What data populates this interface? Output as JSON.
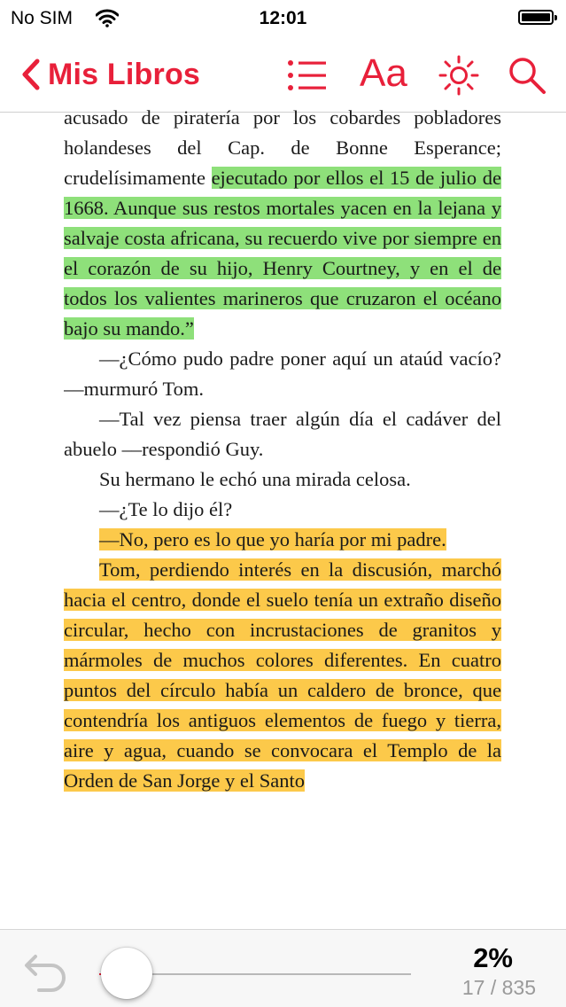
{
  "status": {
    "carrier": "No SIM",
    "time": "12:01",
    "battery_level": 1.0
  },
  "nav": {
    "back_label": "Mis Libros",
    "font_button_label": "Aa",
    "icons": [
      "chevron-left-icon",
      "list-icon",
      "font-size-icon",
      "brightness-icon",
      "search-icon"
    ]
  },
  "colors": {
    "accent": "#e8203a",
    "highlight_green": "#8ee07a",
    "highlight_yellow": "#fcc94a"
  },
  "book": {
    "p1_plain": "acusado de piratería por los cobardes pobladores holandeses del Cap. de Bonne Esperance; crudelísimamente ",
    "p1_highlight": "ejecutado por ellos el 15 de julio de 1668. Aunque sus restos mortales yacen en la lejana y salvaje costa africana, su recuerdo vive por siempre en el corazón de su hijo, Henry Courtney, y en el de todos los valientes marineros que cruzaron el océano bajo su mando.”",
    "p2": "––¿Cómo pudo padre poner aquí un ataúd vacío? ––murmuró Tom.",
    "p3": "––Tal vez piensa traer algún día el cadáver del abuelo ––respondió Guy.",
    "p4": "Su hermano le echó una mirada celosa.",
    "p5": "––¿Te lo dijo él?",
    "p6": "––No, pero es lo que yo haría por mi padre.",
    "p7": "Tom, perdiendo interés en la discusión, marchó hacia el centro, donde el suelo tenía un extraño diseño circular, hecho con incrustaciones de granitos y mármoles de muchos colores diferentes. En cuatro puntos del círculo había un caldero de bronce, que contendría los antiguos elementos de fuego y tierra, aire y agua, cuando se convocara el Templo de la Orden de San Jorge y el Santo"
  },
  "toolbar": {
    "progress_percent": "2%",
    "page_indicator": "17 / 835",
    "progress_fraction": 0.02
  }
}
